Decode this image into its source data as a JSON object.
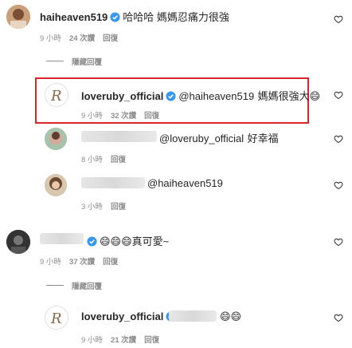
{
  "comments": [
    {
      "username": "haiheaven519",
      "verified": true,
      "text": "哈哈哈 媽媽忍痛力很強",
      "time": "9 小時",
      "likes": "24 次讚",
      "reply_label": "回復"
    },
    {
      "username": "",
      "verified": true,
      "text": "😄😄😄真可愛~",
      "time": "9 小時",
      "likes": "37 次讚",
      "reply_label": "回復"
    }
  ],
  "replies": [
    {
      "username": "loveruby_official",
      "verified": true,
      "mention": "@haiheaven519",
      "text": "媽媽很強大😄",
      "time": "9 小時",
      "likes": "32 次讚",
      "reply_label": "回復",
      "highlighted": true
    },
    {
      "mention": "@loveruby_official",
      "text": "好幸福",
      "time": "8 小時",
      "reply_label": "回復"
    },
    {
      "mention": "@haiheaven519",
      "time": "3 小時",
      "reply_label": "回復"
    },
    {
      "username": "loveruby_official",
      "verified": true,
      "text": "😄😄",
      "time": "9 小時",
      "likes": "21 次讚",
      "reply_label": "回復"
    }
  ],
  "hide_replies_label": "隱藏回覆",
  "colors": {
    "highlight": "#d9262c",
    "verified": "#3897f0",
    "meta": "#8e8e8e"
  },
  "icons": {
    "like": "heart-icon",
    "verified": "verified-badge-icon",
    "emoji": "grinning-face-emoji"
  }
}
